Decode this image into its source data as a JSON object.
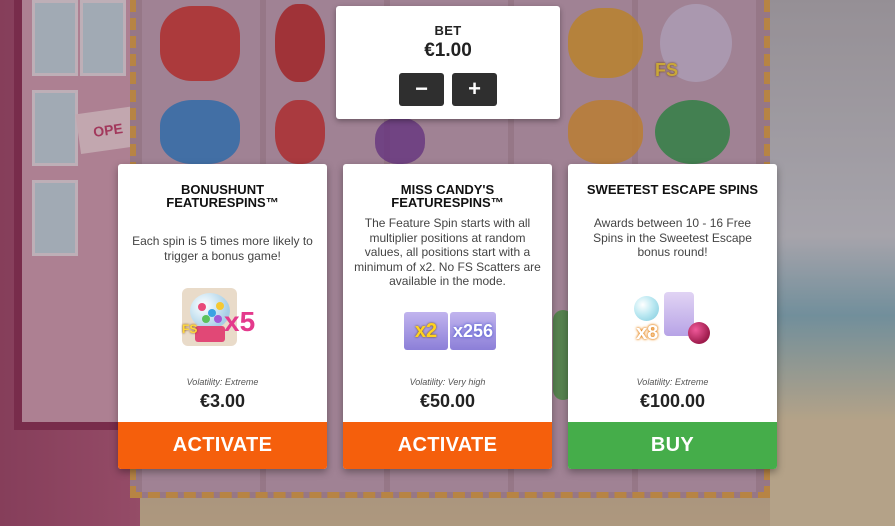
{
  "bet": {
    "label": "BET",
    "amount": "€1.00",
    "decrease_label": "−",
    "increase_label": "+"
  },
  "background": {
    "sign_text": "OPE",
    "fs_symbol": "FS"
  },
  "cards": [
    {
      "title": "BONUSHUNT FEATURESPINS™",
      "description": "Each spin is 5 times more likely to trigger a bonus game!",
      "art": {
        "fs_label": "FS",
        "multiplier": "x5"
      },
      "volatility": "Volatility: Extreme",
      "price": "€3.00",
      "button": "ACTIVATE",
      "button_color": "#f55f0c"
    },
    {
      "title": "MISS CANDY'S FEATURESPINS™",
      "description": "The Feature Spin starts with all multiplier positions at random values, all positions start with a minimum of x2. No FS Scatters are available in the mode.",
      "art": {
        "multiplier_1": "x2",
        "multiplier_2": "x256"
      },
      "volatility": "Volatility: Very high",
      "price": "€50.00",
      "button": "ACTIVATE",
      "button_color": "#f55f0c"
    },
    {
      "title": "SWEETEST ESCAPE SPINS",
      "description": "Awards between 10 - 16 Free Spins in the Sweetest Escape bonus round!",
      "art": {
        "multiplier": "x8"
      },
      "volatility": "Volatility: Extreme",
      "price": "€100.00",
      "button": "BUY",
      "button_color": "#45ad4a"
    }
  ]
}
